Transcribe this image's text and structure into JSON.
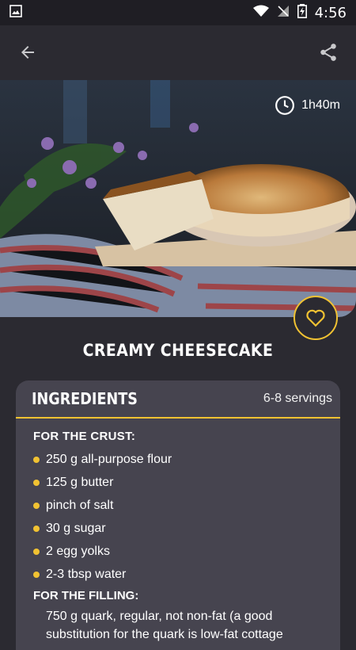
{
  "status": {
    "time": "4:56"
  },
  "appbar": {
    "back_icon": "arrow-back-icon",
    "share_icon": "share-icon"
  },
  "recipe": {
    "duration": "1h40m",
    "title": "CREAMY CHEESECAKE"
  },
  "ingredients": {
    "title": "INGREDIENTS",
    "servings": "6-8 servings",
    "crust": {
      "title": "FOR THE CRUST:",
      "items": [
        "250 g all-purpose flour",
        "125 g butter",
        "pinch of salt",
        "30 g sugar",
        "2 egg yolks",
        "2-3 tbsp water"
      ]
    },
    "filling": {
      "title": "FOR THE FILLING:",
      "text": "750 g quark, regular, not non-fat (a good substitution for the quark is low-fat cottage"
    }
  },
  "colors": {
    "accent": "#f1c232",
    "background": "#2b2a31",
    "card": "#46444f"
  }
}
